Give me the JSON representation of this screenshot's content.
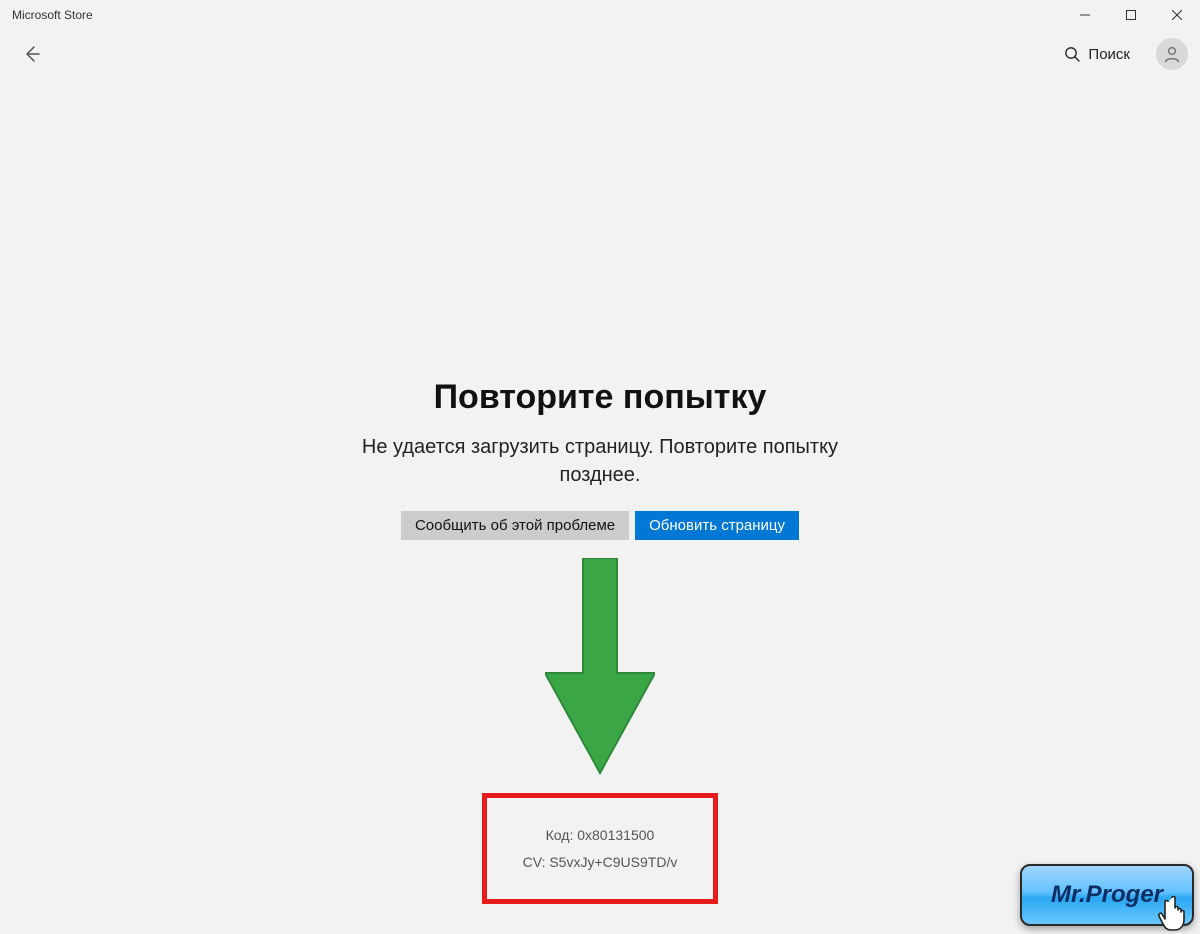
{
  "window": {
    "title": "Microsoft Store"
  },
  "toolbar": {
    "search_label": "Поиск"
  },
  "main": {
    "title": "Повторите попытку",
    "message": "Не удается загрузить страницу. Повторите попытку позднее.",
    "report_label": "Сообщить об этой проблеме",
    "refresh_label": "Обновить страницу",
    "code_line": "Код: 0x80131500",
    "cv_line": "CV: S5vxJy+C9US9TD/v"
  },
  "watermark": {
    "text": "Mr.Proger"
  },
  "annotation": {
    "arrow_color": "#3aa646",
    "highlight_color": "#e51b1b"
  }
}
